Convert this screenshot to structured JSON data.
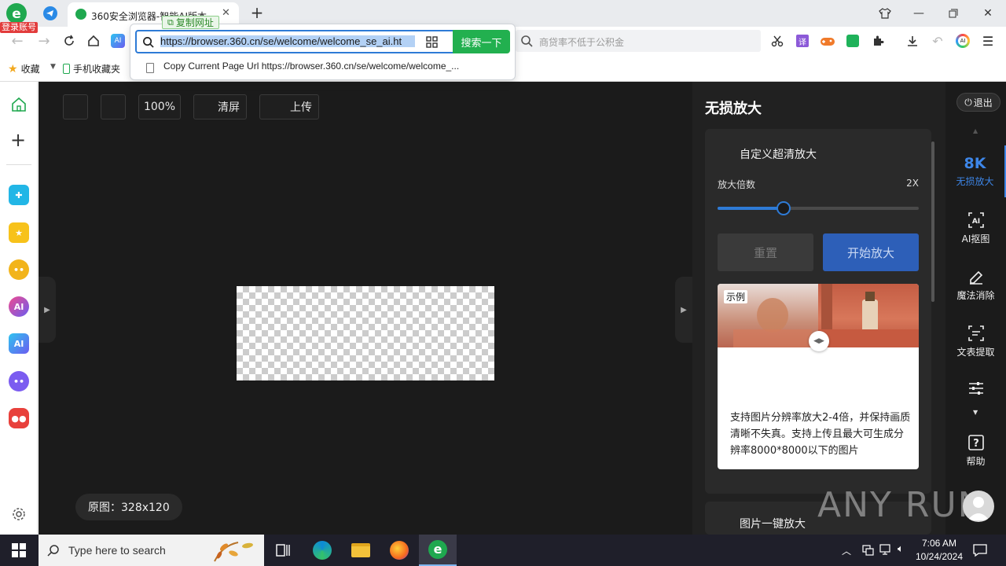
{
  "browser": {
    "login_badge": "登录账号",
    "tab_title": "360安全浏览器-智能AI版本",
    "url": "https://browser.360.cn/se/welcome/welcome_se_ai.ht",
    "search_button": "搜索一下",
    "copy_url_badge": "复制网址",
    "suggestion": "Copy Current Page Url https://browser.360.cn/se/welcome/welcome_...",
    "side_search_placeholder": "商贷率不低于公积金",
    "bookmarks": [
      "收藏",
      "手机收藏夹"
    ]
  },
  "toolbar": {
    "zoom": "100%",
    "clear": "清屏",
    "upload": "上传"
  },
  "canvas": {
    "original_size": "原图：328x120"
  },
  "panel": {
    "title": "无损放大",
    "card_title": "自定义超清放大",
    "scale_label": "放大倍数",
    "scale_value": "2X",
    "slider_fraction": 0.33,
    "reset_button": "重置",
    "start_button": "开始放大",
    "example_badge": "示例",
    "example_desc": "支持图片分辨率放大2-4倍，并保持画质清晰不失真。支持上传且最大可生成分辨率8000*8000以下的图片",
    "card2_title": "图片一键放大"
  },
  "rail": {
    "exit": "退出",
    "items": [
      {
        "icon": "8K",
        "label": "无损放大"
      },
      {
        "label": "AI抠图"
      },
      {
        "label": "魔法消除"
      },
      {
        "label": "文表提取"
      },
      {
        "label": "帮助"
      }
    ]
  },
  "watermark": "ANY RUN",
  "taskbar": {
    "search_placeholder": "Type here to search",
    "time": "7:06 AM",
    "date": "10/24/2024"
  },
  "colors": {
    "accent": "#2e7bd6",
    "search_green": "#22b04f",
    "canvas_bg": "#1b1b1b"
  }
}
